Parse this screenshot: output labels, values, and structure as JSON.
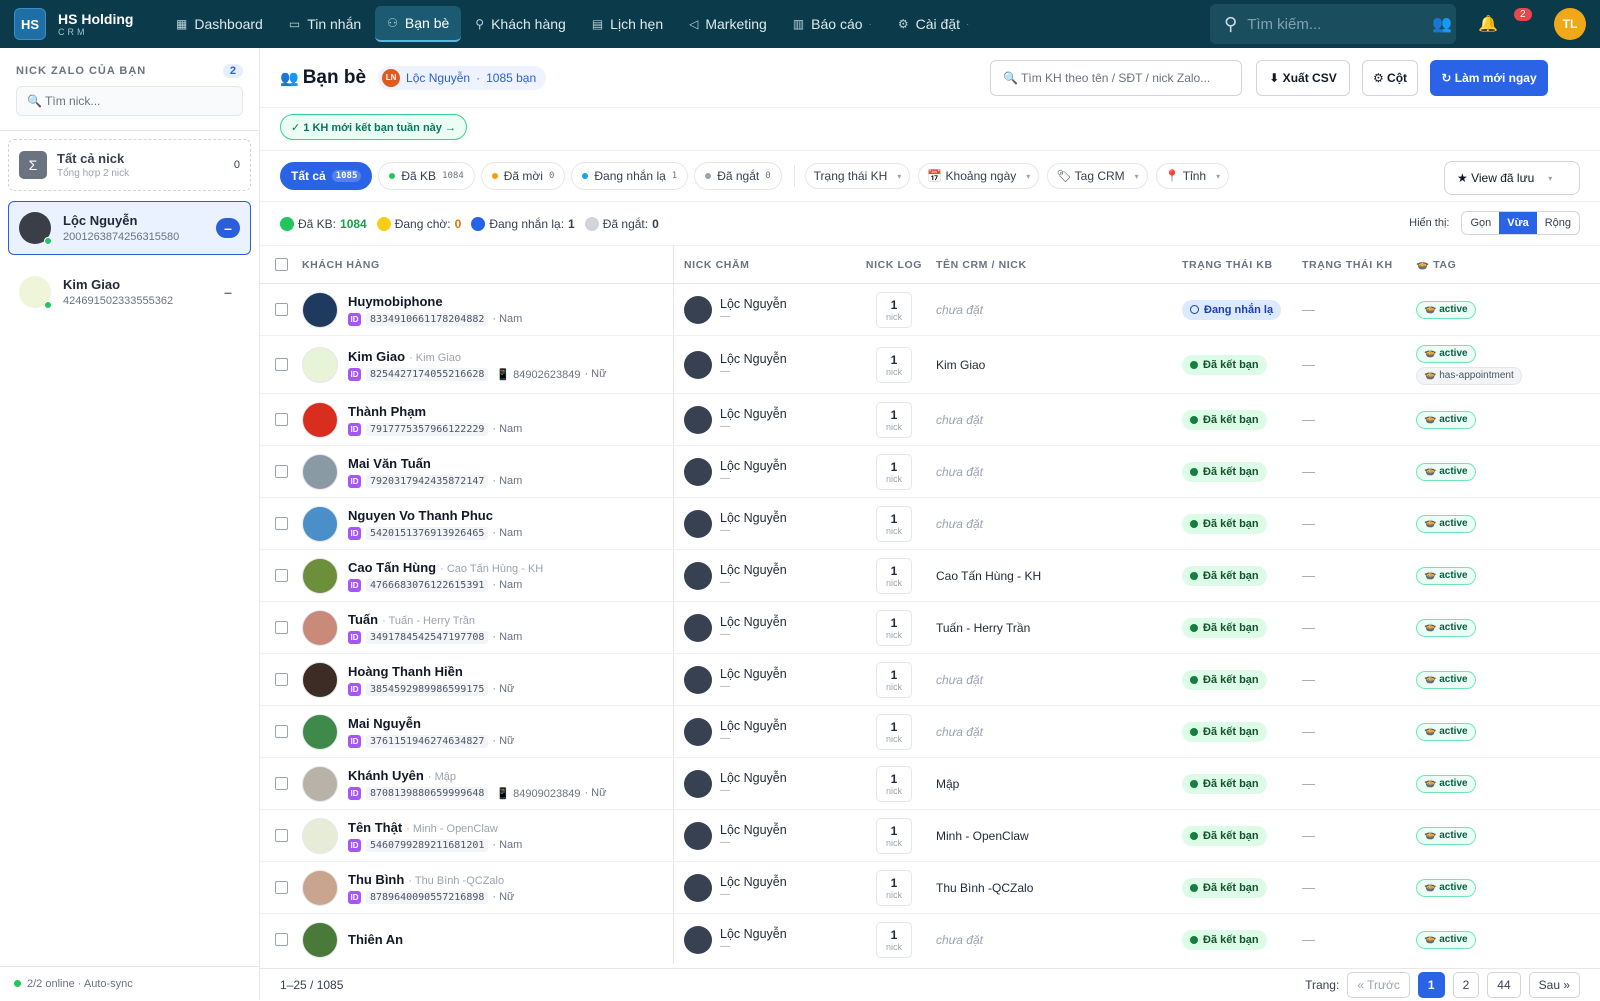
{
  "app": {
    "brand": "HS Holding",
    "brand_sub": "CRM",
    "logo": "HS"
  },
  "nav": [
    {
      "label": "Dashboard",
      "icon": "grid-icon"
    },
    {
      "label": "Tin nhắn",
      "icon": "chat-icon"
    },
    {
      "label": "Bạn bè",
      "icon": "users-icon",
      "active": true
    },
    {
      "label": "Khách hàng",
      "icon": "user-icon"
    },
    {
      "label": "Lịch hẹn",
      "icon": "calendar-icon"
    },
    {
      "label": "Marketing",
      "icon": "megaphone-icon"
    },
    {
      "label": "Báo cáo",
      "icon": "report-icon"
    },
    {
      "label": "Cài đặt",
      "icon": "gear-icon"
    }
  ],
  "topbar": {
    "search_placeholder": "Tìm kiếm...",
    "notif_count": "2",
    "user_initials": "TL"
  },
  "sidebar": {
    "title": "NICK ZALO CỦA BẠN",
    "count": "2",
    "search_placeholder": "🔍 Tìm nick...",
    "all": {
      "name": "Tất cả nick",
      "sub": "Tổng hợp 2 nick",
      "count": "0"
    },
    "nicks": [
      {
        "name": "Lộc Nguyễn",
        "id": "2001263874256315580",
        "selected": true
      },
      {
        "name": "Kim Giao",
        "id": "424691502333555362",
        "selected": false
      }
    ],
    "footer": "2/2 online · Auto-sync"
  },
  "header": {
    "title": "Bạn bè",
    "nick_initials": "LN",
    "nick_name": "Lộc Nguyễn",
    "nick_sep": "·",
    "nick_count": "1085 bạn",
    "search_placeholder": "🔍 Tìm KH theo tên / SĐT / nick Zalo...",
    "export_label": "⬇ Xuất CSV",
    "columns_label": "⚙ Cột",
    "refresh_label": "↻ Làm mới ngay",
    "notice": "✓ 1 KH mới kết bạn tuần này →"
  },
  "filters": {
    "tabs": [
      {
        "label": "Tất cả",
        "count": "1085",
        "active": true
      },
      {
        "label": "Đã KB",
        "count": "1084",
        "dot": "#22c55e"
      },
      {
        "label": "Đã mời",
        "count": "0",
        "dot": "#f59e0b"
      },
      {
        "label": "Đang nhắn lạ",
        "count": "1",
        "dot": "#0ea5e9"
      },
      {
        "label": "Đã ngắt",
        "count": "0",
        "dot": "#9ca3af"
      }
    ],
    "selects": [
      "Trạng thái KH",
      "📅 Khoảng ngày",
      "🏷 Tag CRM",
      "📍 Tỉnh"
    ],
    "view_saved": "★ View đã lưu"
  },
  "stats": {
    "items": [
      {
        "label": "Đã KB:",
        "value": "1084",
        "color": "#22c55e"
      },
      {
        "label": "Đang chờ:",
        "value": "0",
        "color": "#facc15"
      },
      {
        "label": "Đang nhắn lạ:",
        "value": "1",
        "color": "#2563eb"
      },
      {
        "label": "Đã ngắt:",
        "value": "0",
        "color": "#d1d5db"
      }
    ],
    "density_label": "Hiển thị:",
    "density_options": [
      "Gọn",
      "Vừa",
      "Rộng"
    ],
    "density_selected": "Vừa"
  },
  "table": {
    "columns": [
      "KHÁCH HÀNG",
      "NICK CHĂM",
      "NICK LOG",
      "TÊN CRM / NICK",
      "TRẠNG THÁI KB",
      "TRẠNG THÁI KH",
      "🍲 TAG"
    ],
    "nick_log_unit": "nick",
    "rows": [
      {
        "name": "Huymobiphone",
        "alias": "",
        "id": "8334910661178204882",
        "phone": "",
        "gender": "· Nam",
        "nick": "Lộc Nguyễn",
        "log": "1",
        "crm": "",
        "status": "Đang nhắn lạ",
        "status_type": "nl",
        "tags": [
          "🍲 active"
        ],
        "color": "#1e3a5f"
      },
      {
        "name": "Kim Giao",
        "alias": "· Kim Giao",
        "id": "8254427174055216628",
        "phone": "📱 84902623849",
        "gender": "· Nữ",
        "nick": "Lộc Nguyễn",
        "log": "1",
        "crm": "Kim Giao",
        "status": "Đã kết bạn",
        "status_type": "ok",
        "tags": [
          "🍲 active",
          "🍲 has-appointment"
        ],
        "color": "#e8f4d8"
      },
      {
        "name": "Thành Phạm",
        "alias": "",
        "id": "7917775357966122229",
        "phone": "",
        "gender": "· Nam",
        "nick": "Lộc Nguyễn",
        "log": "1",
        "crm": "",
        "status": "Đã kết bạn",
        "status_type": "ok",
        "tags": [
          "🍲 active"
        ],
        "color": "#d92d20"
      },
      {
        "name": "Mai Văn Tuấn",
        "alias": "",
        "id": "7920317942435872147",
        "phone": "",
        "gender": "· Nam",
        "nick": "Lộc Nguyễn",
        "log": "1",
        "crm": "",
        "status": "Đã kết bạn",
        "status_type": "ok",
        "tags": [
          "🍲 active"
        ],
        "color": "#8a9aa5"
      },
      {
        "name": "Nguyen Vo Thanh Phuc",
        "alias": "",
        "id": "5420151376913926465",
        "phone": "",
        "gender": "· Nam",
        "nick": "Lộc Nguyễn",
        "log": "1",
        "crm": "",
        "status": "Đã kết bạn",
        "status_type": "ok",
        "tags": [
          "🍲 active"
        ],
        "color": "#4a8fc7"
      },
      {
        "name": "Cao Tấn Hùng",
        "alias": "· Cao Tấn Hùng - KH",
        "id": "4766683076122615391",
        "phone": "",
        "gender": "· Nam",
        "nick": "Lộc Nguyễn",
        "log": "1",
        "crm": "Cao Tấn Hùng - KH",
        "status": "Đã kết bạn",
        "status_type": "ok",
        "tags": [
          "🍲 active"
        ],
        "color": "#6b8f3a"
      },
      {
        "name": "Tuấn",
        "alias": "· Tuấn - Herry Trần",
        "id": "3491784542547197708",
        "phone": "",
        "gender": "· Nam",
        "nick": "Lộc Nguyễn",
        "log": "1",
        "crm": "Tuấn - Herry Trần",
        "status": "Đã kết bạn",
        "status_type": "ok",
        "tags": [
          "🍲 active"
        ],
        "color": "#c98a7a"
      },
      {
        "name": "Hoàng Thanh Hiền",
        "alias": "",
        "id": "3854592989986599175",
        "phone": "",
        "gender": "· Nữ",
        "nick": "Lộc Nguyễn",
        "log": "1",
        "crm": "",
        "status": "Đã kết bạn",
        "status_type": "ok",
        "tags": [
          "🍲 active"
        ],
        "color": "#3d2b26"
      },
      {
        "name": "Mai Nguyễn",
        "alias": "",
        "id": "3761151946274634827",
        "phone": "",
        "gender": "· Nữ",
        "nick": "Lộc Nguyễn",
        "log": "1",
        "crm": "",
        "status": "Đã kết bạn",
        "status_type": "ok",
        "tags": [
          "🍲 active"
        ],
        "color": "#3f8a4a"
      },
      {
        "name": "Khánh Uyên",
        "alias": "· Mập",
        "id": "8708139880659999648",
        "phone": "📱 84909023849",
        "gender": "· Nữ",
        "nick": "Lộc Nguyễn",
        "log": "1",
        "crm": "Mập",
        "status": "Đã kết bạn",
        "status_type": "ok",
        "tags": [
          "🍲 active"
        ],
        "color": "#b8b2a8"
      },
      {
        "name": "Tên Thật",
        "alias": "· Minh - OpenClaw",
        "id": "5460799289211681201",
        "phone": "",
        "gender": "· Nam",
        "nick": "Lộc Nguyễn",
        "log": "1",
        "crm": "Minh - OpenClaw",
        "status": "Đã kết bạn",
        "status_type": "ok",
        "tags": [
          "🍲 active"
        ],
        "color": "#e6ecd6"
      },
      {
        "name": "Thu Bình",
        "alias": "· Thu Bình -QCZalo",
        "id": "8789640090557216898",
        "phone": "",
        "gender": "· Nữ",
        "nick": "Lộc Nguyễn",
        "log": "1",
        "crm": "Thu Bình -QCZalo",
        "status": "Đã kết bạn",
        "status_type": "ok",
        "tags": [
          "🍲 active"
        ],
        "color": "#c9a58e"
      },
      {
        "name": "Thiên An",
        "alias": "",
        "id": "",
        "phone": "",
        "gender": "",
        "nick": "Lộc Nguyễn",
        "log": "1",
        "crm": "",
        "status": "Đã kết bạn",
        "status_type": "ok",
        "tags": [
          "🍲 active"
        ],
        "color": "#4a7a3a"
      }
    ],
    "crm_empty": "chưa đặt",
    "kh_empty": "—",
    "nick_sub": "—"
  },
  "footer": {
    "range": "1–25 / 1085",
    "page_label": "Trang:",
    "prev": "« Trước",
    "pages": [
      "1",
      "2",
      "44"
    ],
    "current": "1",
    "next": "Sau »"
  }
}
